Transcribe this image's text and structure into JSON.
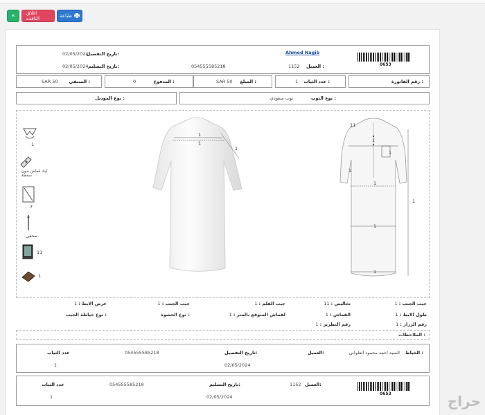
{
  "toolbar": {
    "back_icon": "double-chevron-left-icon",
    "close_label": "اغلاق النافذه",
    "print_label": "طباعة",
    "print_icon": "printer-icon",
    "colors": {
      "back": "#26b26b",
      "close": "#e0465e",
      "print": "#2f78d1"
    }
  },
  "header": {
    "customer_name": "Ahmed Nagib",
    "customer_label": "العميل :",
    "customer_number": "1152",
    "phone": "054555585218",
    "detail_date_label": "تاريخ التفصيل:",
    "detail_date": "02/05/2024",
    "delivery_date_label": "تاريخ التسليم:",
    "delivery_date": "02/05/2024",
    "barcode_number": "0653"
  },
  "invoice": {
    "invoice_no_label": "رقم الفاتورة :",
    "pieces_label": "عدد الثياب :",
    "pieces_value": "1",
    "amount_label": "المبلغ :",
    "amount_value": "SAR 50",
    "paid_label": "المدفوع :",
    "paid_value": "0",
    "remaining_label": "المتبقي :",
    "remaining_value": "SAR 50"
  },
  "garment": {
    "type_label": "نوع الثوب :",
    "type_value": "ثوب سعودي",
    "model_label": "نوع الموديل :"
  },
  "side_options": {
    "items": [
      {
        "icon": "collar-icon",
        "value": "1"
      },
      {
        "icon": "cuff-icon",
        "caption": "كبك قماش بدون سفطة"
      },
      {
        "icon": "placket-icon",
        "value": "7"
      },
      {
        "icon": "pen-pocket-icon",
        "caption": "مخفي"
      },
      {
        "icon": "phone-pocket-icon",
        "value": "11"
      },
      {
        "icon": "fabric-swatch-icon",
        "value": "1"
      }
    ]
  },
  "back_figure": {
    "measure_shoulder": "1",
    "measure_chest": "1",
    "measure_side": "1"
  },
  "front_figure": {
    "measure_neck": "11",
    "measure_chest": "1",
    "measure_pocket": "1",
    "measure_sleeve": "1",
    "measure_length": "1",
    "measure_hem": "1",
    "measure_waist": "1",
    "measure_hip": "1"
  },
  "details": {
    "row1": [
      {
        "label": "جيب الجنب :",
        "value": "1"
      },
      {
        "label": "تخاليص :",
        "value": "11"
      },
      {
        "label": "جيب القلم :",
        "value": "1"
      },
      {
        "label": "جيب الجنب :",
        "value": "1"
      },
      {
        "label": "عرض الابط :",
        "value": "1"
      }
    ],
    "row2": [
      {
        "label": "طول الابط :",
        "value": "1"
      },
      {
        "label": "القماش :",
        "value": "1"
      },
      {
        "label": "لقماش المتوقع بالمتر :",
        "value": "1"
      },
      {
        "label": "نوع الحشوة :",
        "value": ""
      },
      {
        "label": "نوع خياطة الجيب :",
        "value": ""
      }
    ],
    "row3": [
      {
        "label": "رقم الزرار :",
        "value": "1"
      },
      {
        "label": "رقم التطريز :",
        "value": "1"
      }
    ]
  },
  "notes": {
    "label": "الملاحظات :"
  },
  "tailor_slip": {
    "tailor_label": "الخياط :",
    "tailor_name": "السيد احمد محمود العلواني",
    "customer_label": "العميل:",
    "detail_date_label": "تاريخ التفصيل:",
    "detail_date": "02/05/2024",
    "phone": "054555585218",
    "pieces_label": "عدد الثياب",
    "pieces_value": "1"
  },
  "customer_slip": {
    "customer_label": "العميل:",
    "customer_number": "1152",
    "delivery_date_label": "تاريخ التسليم:",
    "delivery_date": "02/05/2024",
    "phone": "054555585218",
    "pieces_label": "عدد الثياب",
    "pieces_value": "1",
    "barcode_number": "0653"
  },
  "watermark": "حراج"
}
